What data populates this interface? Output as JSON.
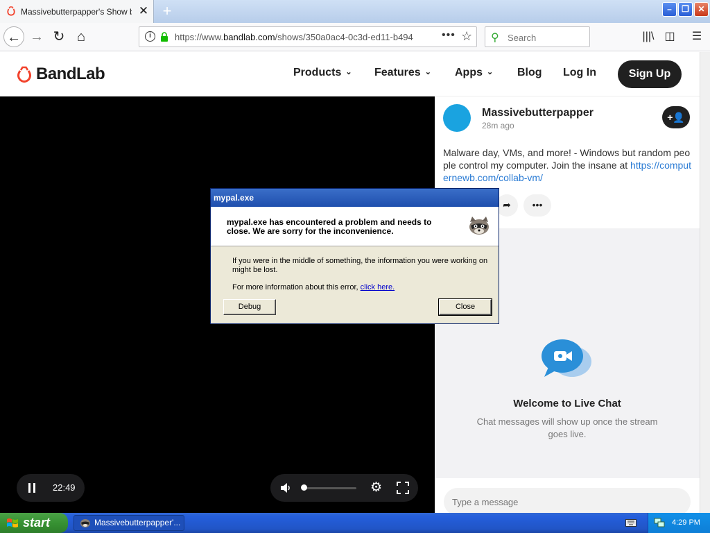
{
  "browser": {
    "tab_title": "Massivebutterpapper's Show by Massivebutterpapper",
    "url_prefix": "https://www.",
    "url_host": "bandlab.com",
    "url_path": "/shows/350a0ac4-0c3d-ed11-b494",
    "search_placeholder": "Search"
  },
  "site": {
    "logo_text": "BandLab",
    "nav": [
      "Products",
      "Features",
      "Apps",
      "Blog",
      "Log In"
    ],
    "signup": "Sign Up"
  },
  "video": {
    "time": "22:49",
    "volume_level": 0.05
  },
  "post": {
    "username": "Massivebutterpapper",
    "time_ago": "28m ago",
    "description": "Malware day, VMs, and more! - Windows but random people control my computer. Join the insane at ",
    "link": "https://computernewb.com/collab-vm/",
    "more_label": "•••"
  },
  "chat": {
    "title": "Welcome to Live Chat",
    "subtitle": "Chat messages will show up once the stream goes live.",
    "input_placeholder": "Type a message"
  },
  "dialog": {
    "title": "mypal.exe",
    "headline": "mypal.exe has encountered a problem and needs to close.  We are sorry for the inconvenience.",
    "body1": "If you were in the middle of something, the information you were working on might be lost.",
    "body2_prefix": "For more information about this error, ",
    "body2_link": "click here.",
    "debug_label": "Debug",
    "close_label": "Close"
  },
  "taskbar": {
    "start_label": "start",
    "task_item": "Massivebutterpapper'...",
    "clock": "4:29 PM"
  },
  "colors": {
    "brand_red": "#f2422c",
    "link_blue": "#2a7bd4",
    "chat_icon_blue": "#2a8fd8"
  }
}
